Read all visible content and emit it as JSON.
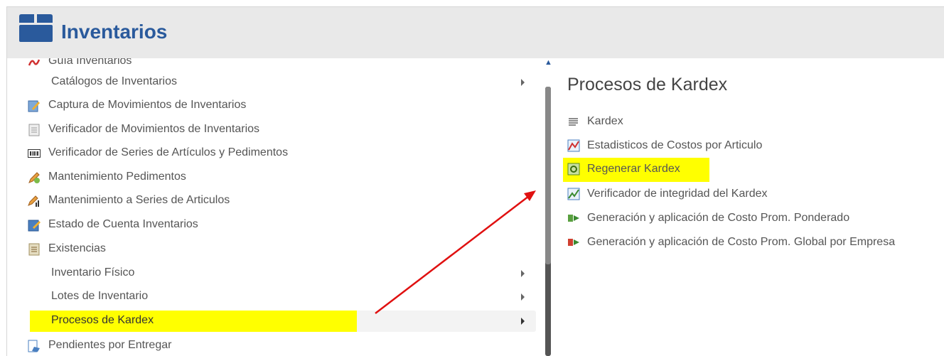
{
  "header": {
    "title": "Inventarios"
  },
  "menu": {
    "items": [
      {
        "label": "Guía Inventarios",
        "icon": "pdf-icon"
      },
      {
        "label": "Catálogos de Inventarios",
        "submenu": true
      },
      {
        "label": "Captura de Movimientos de Inventarios",
        "icon": "edit-form-icon"
      },
      {
        "label": "Verificador de Movimientos de Inventarios",
        "icon": "document-icon"
      },
      {
        "label": "Verificador de Series de Artículos y Pedimentos",
        "icon": "barcode-icon"
      },
      {
        "label": "Mantenimiento Pedimentos",
        "icon": "pencil-icon"
      },
      {
        "label": "Mantenimiento a Series de Articulos",
        "icon": "pencil-chart-icon"
      },
      {
        "label": "Estado de Cuenta Inventarios",
        "icon": "edit-icon"
      },
      {
        "label": "Existencias",
        "icon": "list-icon"
      },
      {
        "label": "Inventario Físico",
        "submenu": true
      },
      {
        "label": "Lotes de Inventario",
        "submenu": true
      },
      {
        "label": "Procesos de Kardex",
        "submenu": true,
        "active": true
      },
      {
        "label": "Pendientes por Entregar",
        "icon": "delivery-icon"
      }
    ]
  },
  "panel": {
    "title": "Procesos de Kardex",
    "items": [
      {
        "label": "Kardex",
        "icon": "lines-icon"
      },
      {
        "label": "Estadisticos de Costos por Articulo",
        "icon": "stats-chart-icon"
      },
      {
        "label": "Regenerar Kardex",
        "icon": "regenerate-icon",
        "highlighted": true
      },
      {
        "label": "Verificador de integridad del Kardex",
        "icon": "line-chart-icon"
      },
      {
        "label": "Generación y aplicación de Costo Prom. Ponderado",
        "icon": "transfer-green-icon"
      },
      {
        "label": "Generación y aplicación de Costo Prom. Global por Empresa",
        "icon": "transfer-red-icon"
      }
    ]
  },
  "colors": {
    "accent": "#2a5a9c",
    "highlight": "#ffff00",
    "arrow": "#e01010"
  }
}
